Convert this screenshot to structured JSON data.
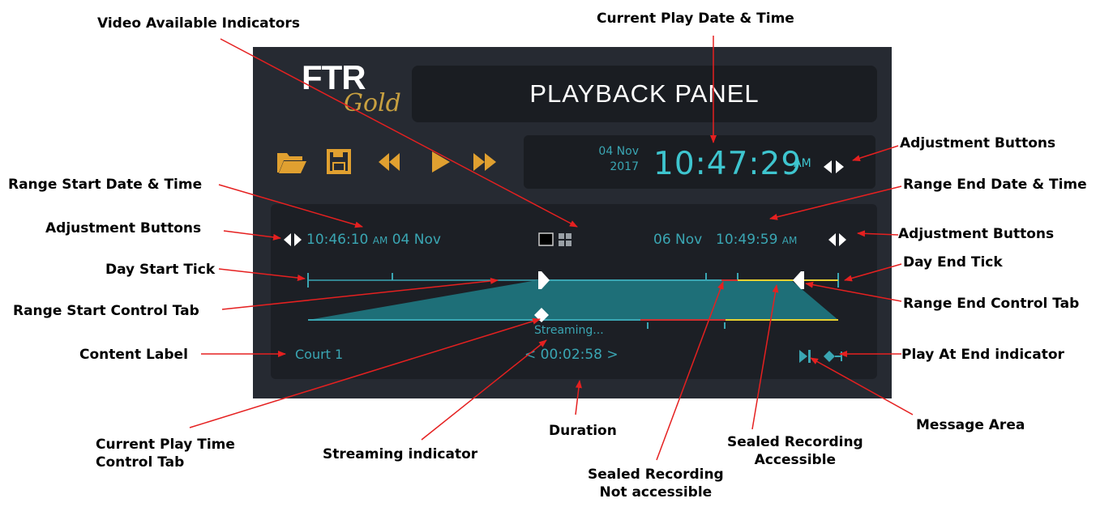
{
  "app": {
    "logo_main": "FTR",
    "logo_sub": "Gold",
    "title": "PLAYBACK PANEL"
  },
  "toolbar": {
    "items": [
      {
        "name": "open-folder",
        "icon": "folder-open-icon"
      },
      {
        "name": "save",
        "icon": "floppy-disk-icon"
      },
      {
        "name": "rewind",
        "icon": "rewind-icon"
      },
      {
        "name": "play",
        "icon": "play-icon"
      },
      {
        "name": "fast-forward",
        "icon": "fast-forward-icon"
      }
    ],
    "icon_color": "#e0a030"
  },
  "clock": {
    "day_month": "04 Nov",
    "year": "2017",
    "time": "10:47:29",
    "ampm": "AM",
    "adjust_icon": "left-right-arrows-icon"
  },
  "range": {
    "start_time": "10:46:10",
    "start_ampm": "AM",
    "start_date": "04 Nov",
    "end_date": "06 Nov",
    "end_time": "10:49:59",
    "end_ampm": "AM",
    "video_indicators": [
      "single-view-icon",
      "grid-view-icon"
    ]
  },
  "timeline": {
    "streaming_text": "Streaming...",
    "duration_text": "< 00:02:58 >",
    "content_label": "Court 1",
    "play_at_end_icon": "play-at-end-icon",
    "colors": {
      "track": "#3aa6b3",
      "fill": "#1e6f78",
      "sealed_not_accessible": "#d03030",
      "sealed_accessible": "#e6d030"
    }
  },
  "annotations": {
    "video_available": "Video Available Indicators",
    "current_play_dt": "Current Play Date & Time",
    "adjust_top": "Adjustment Buttons",
    "range_start_dt": "Range Start Date & Time",
    "range_end_dt": "Range End Date & Time",
    "adjust_left": "Adjustment Buttons",
    "adjust_right": "Adjustment Buttons",
    "day_start_tick": "Day Start Tick",
    "day_end_tick": "Day End Tick",
    "range_start_tab": "Range Start Control Tab",
    "range_end_tab": "Range End Control Tab",
    "content_label": "Content Label",
    "play_at_end": "Play At End indicator",
    "current_play_tab_1": "Current Play Time",
    "current_play_tab_2": "Control Tab",
    "streaming_indicator": "Streaming indicator",
    "duration": "Duration",
    "message_area": "Message Area",
    "sealed_accessible_1": "Sealed Recording",
    "sealed_accessible_2": "Accessible",
    "sealed_not_1": "Sealed Recording",
    "sealed_not_2": "Not accessible"
  }
}
